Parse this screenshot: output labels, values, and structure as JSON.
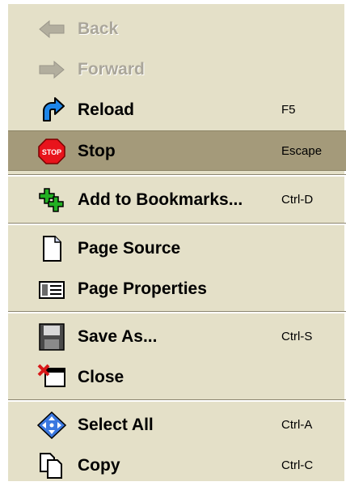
{
  "menu": {
    "items": [
      {
        "label": "Back",
        "accel": "",
        "icon": "back-arrow-icon",
        "disabled": true
      },
      {
        "label": "Forward",
        "accel": "",
        "icon": "forward-arrow-icon",
        "disabled": true
      },
      {
        "label": "Reload",
        "accel": "F5",
        "icon": "reload-icon",
        "disabled": false
      },
      {
        "label": "Stop",
        "accel": "Escape",
        "icon": "stop-sign-icon",
        "disabled": false,
        "selected": true
      },
      {
        "label": "Add to Bookmarks...",
        "accel": "Ctrl-D",
        "icon": "add-bookmark-icon",
        "disabled": false
      },
      {
        "label": "Page Source",
        "accel": "",
        "icon": "page-source-icon",
        "disabled": false
      },
      {
        "label": "Page Properties",
        "accel": "",
        "icon": "page-properties-icon",
        "disabled": false
      },
      {
        "label": "Save As...",
        "accel": "Ctrl-S",
        "icon": "save-disk-icon",
        "disabled": false
      },
      {
        "label": "Close",
        "accel": "",
        "icon": "close-window-icon",
        "disabled": false
      },
      {
        "label": "Select All",
        "accel": "Ctrl-A",
        "icon": "select-all-icon",
        "disabled": false
      },
      {
        "label": "Copy",
        "accel": "Ctrl-C",
        "icon": "copy-icon",
        "disabled": false
      }
    ]
  },
  "colors": {
    "menu_background": "#e4e0c8",
    "selected_background": "#a49a7a",
    "disabled_text": "#aaa69a"
  }
}
